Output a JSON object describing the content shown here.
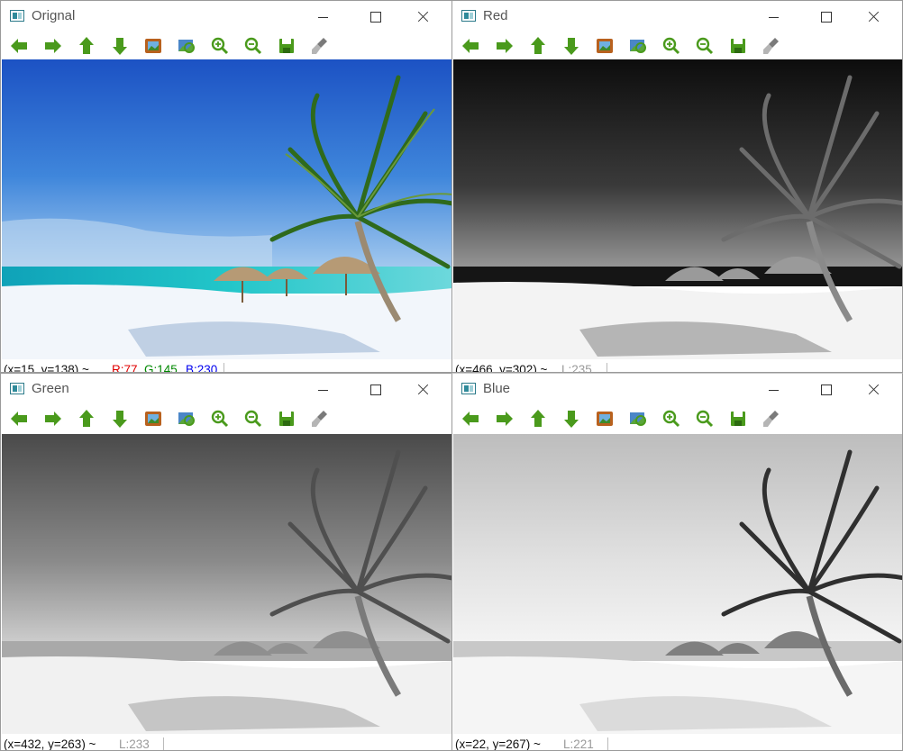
{
  "windows": {
    "original": {
      "title": "Orignal",
      "coords": "(x=15, y=138) ~",
      "r": "R:77",
      "g": "G:145",
      "b": "B:230"
    },
    "red": {
      "title": "Red",
      "coords": "(x=466, y=302) ~",
      "l": "L:235"
    },
    "green": {
      "title": "Green",
      "coords": "(x=432, y=263) ~",
      "l": "L:233"
    },
    "blue": {
      "title": "Blue",
      "coords": "(x=22, y=267) ~",
      "l": "L:221"
    }
  },
  "toolbar_icons": [
    "arrow-left-icon",
    "arrow-right-icon",
    "arrow-up-icon",
    "arrow-down-icon",
    "image-icon",
    "zoom-fit-icon",
    "zoom-in-icon",
    "zoom-out-icon",
    "save-icon",
    "brush-icon"
  ],
  "colors": {
    "icon_green": "#4a9a1c",
    "status_red": "#e00000",
    "status_green": "#008800",
    "status_blue": "#0000ee"
  }
}
